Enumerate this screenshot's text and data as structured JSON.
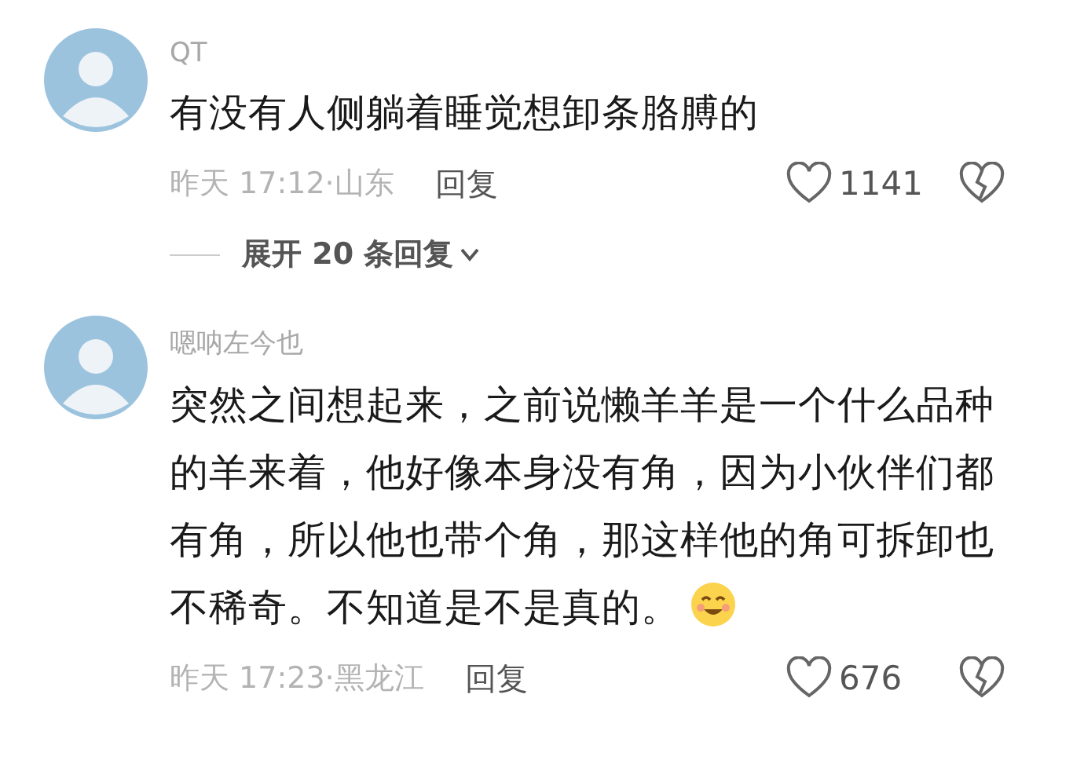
{
  "comments": [
    {
      "username": "QT",
      "text": "有没有人侧躺着睡觉想卸条胳膊的",
      "emoji": false,
      "meta": "昨天 17:12·山东",
      "reply": "回复",
      "likes": "1141",
      "expand": "展开 20 条回复"
    },
    {
      "username": "嗯呐左今也",
      "text": "突然之间想起来，之前说懒羊羊是一个什么品种的羊来着，他好像本身没有角，因为小伙伴们都有角，所以他也带个角，那这样他的角可拆卸也不稀奇。不知道是不是真的。",
      "emoji": true,
      "meta": "昨天 17:23·黑龙江",
      "reply": "回复",
      "likes": "676"
    }
  ]
}
